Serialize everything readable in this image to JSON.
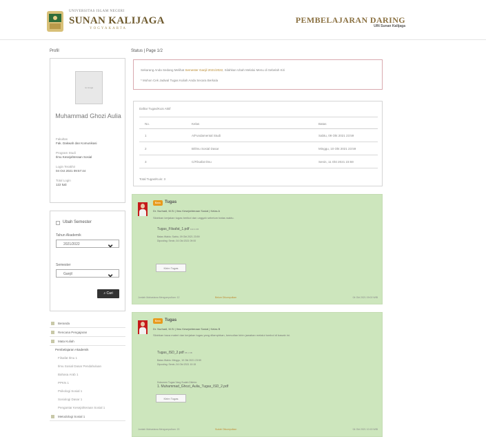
{
  "header": {
    "uni_top": "UNIVERSITAS ISLAM NEGERI",
    "uni_name": "SUNAN KALIJAGA",
    "uni_city": "YOGYAKARTA",
    "site_title": "PEMBELAJARAN DARING",
    "site_sub": "UIN Sunan Kalijaga"
  },
  "colors": {
    "accent": "#8a7040",
    "post_bg": "#cde6bd",
    "badge": "#e89a1e",
    "alert_border": "#d8a8ae"
  },
  "sidebar": {
    "profil_title": "Profil",
    "avatar_text": "no image",
    "name": "Muhammad Ghozi Aulia",
    "fields": [
      {
        "label": "Fakultas",
        "value": "Fak. Dakwah dan Komunikasi"
      },
      {
        "label": "Program Studi",
        "value": "Ilmu Kesejahteraan Sosial"
      },
      {
        "label": "Login Terakhir",
        "value": "04 Oct 2021 09:57:44"
      },
      {
        "label": "Total Login",
        "value": "122 kali"
      }
    ],
    "filter": {
      "checkbox_label": "Ubah Semester",
      "tahun_label": "Tahun Akademik",
      "tahun_value": "2021/2022",
      "semester_label": "Semester",
      "semester_value": "Ganjil",
      "button_label": "Cari"
    },
    "menu": [
      {
        "label": "Beranda",
        "type": "major"
      },
      {
        "label": "Rencana Pengajaran",
        "type": "major"
      },
      {
        "label": "Mata Kuliah",
        "type": "major"
      },
      {
        "label": "Pembelajaran Akademik",
        "type": "subhead"
      },
      {
        "label": "Filsafat Ilmu 1",
        "type": "sub"
      },
      {
        "label": "Ilmu Sosial Dasar Pendahuluan",
        "type": "sub"
      },
      {
        "label": "Bahasa Arab 1",
        "type": "sub"
      },
      {
        "label": "PPKN 1",
        "type": "sub"
      },
      {
        "label": "Psikologi Sosial 1",
        "type": "sub"
      },
      {
        "label": "Sosiologi Dasar 1",
        "type": "sub"
      },
      {
        "label": "Pengantar Kesejahteraan Sosial 1",
        "type": "sub"
      },
      {
        "label": "Metodologi Sosial 1",
        "type": "major"
      }
    ]
  },
  "main": {
    "breadcrumb": "Status | Page 1/2",
    "alert": {
      "line1_pre": "Sekarang Anda Sedang Melihat ",
      "line1_highlight": "Semester Ganjil 2021/2022",
      "line1_post": ", Silahkan Ubah Melalui Menu di Sebelah Kiri",
      "line2": "* Mohon Cek Jadwal Tugas Kuliah Anda Secara Berkala"
    },
    "table": {
      "title": "Daftar Tugas/Kuis Aktif",
      "headers": [
        "No.",
        "Kelas",
        "Batas"
      ],
      "rows": [
        [
          "1",
          "A/Fundamental Studi",
          "Sabtu, 09 Okt 2021 23:59"
        ],
        [
          "2",
          "B/Ilmu Sosial Dasar",
          "Minggu, 10 Okt 2021 23:59"
        ],
        [
          "3",
          "C/Filsafat Ilmu",
          "Senin, 11 Okt 2021 23:59"
        ]
      ],
      "footer": "Total Tugas/Kuis: 3"
    },
    "posts": [
      {
        "badge": "Baru",
        "kind": "Tugas",
        "author": "Dr. Nurhadi, M.Si | Ilmu Kesejahteraan Sosial | Kelas A",
        "desc": "Silahkan kerjakan tugas berikut dan unggah sebelum batas waktu.",
        "file_name": "Tugas_Filsafat_1.pdf",
        "file_size": "102.4 KB",
        "meta": [
          "Batas Waktu: Sabtu, 09 Okt 2021 23:59",
          "Diposting: Senin, 04 Okt 2021 09:00"
        ],
        "button": "Kirim Tugas",
        "foot_left": "Jumlah Mahasiswa Mengumpulkan: 12",
        "foot_mid": "Belum Dikumpulkan",
        "foot_right": "04 Okt 2021 09:00 WIB"
      },
      {
        "badge": "Baru",
        "kind": "Tugas",
        "author": "Dr. Nurhadi, M.Si | Ilmu Kesejahteraan Sosial | Kelas B",
        "desc": "Silahkan baca materi dan kerjakan tugas yang dilampirkan, kemudian kirim jawaban melalui tombol di bawah ini.",
        "file_name": "Tugas_ISD_2.pdf",
        "file_size": "88.1 KB",
        "meta": [
          "Batas Waktu: Minggu, 10 Okt 2021 23:59",
          "Diposting: Senin, 04 Okt 2021 10:15"
        ],
        "note_label": "Dokumen Tugas Yang Sudah Dikirim:",
        "note_file": "1. Muhammad_Ghozi_Aulia_Tugas_ISD_2.pdf",
        "button": "Kirim Tugas",
        "foot_left": "Jumlah Mahasiswa Mengumpulkan: 20",
        "foot_mid": "Sudah Dikumpulkan",
        "foot_right": "04 Okt 2021 10:15 WIB"
      }
    ]
  }
}
